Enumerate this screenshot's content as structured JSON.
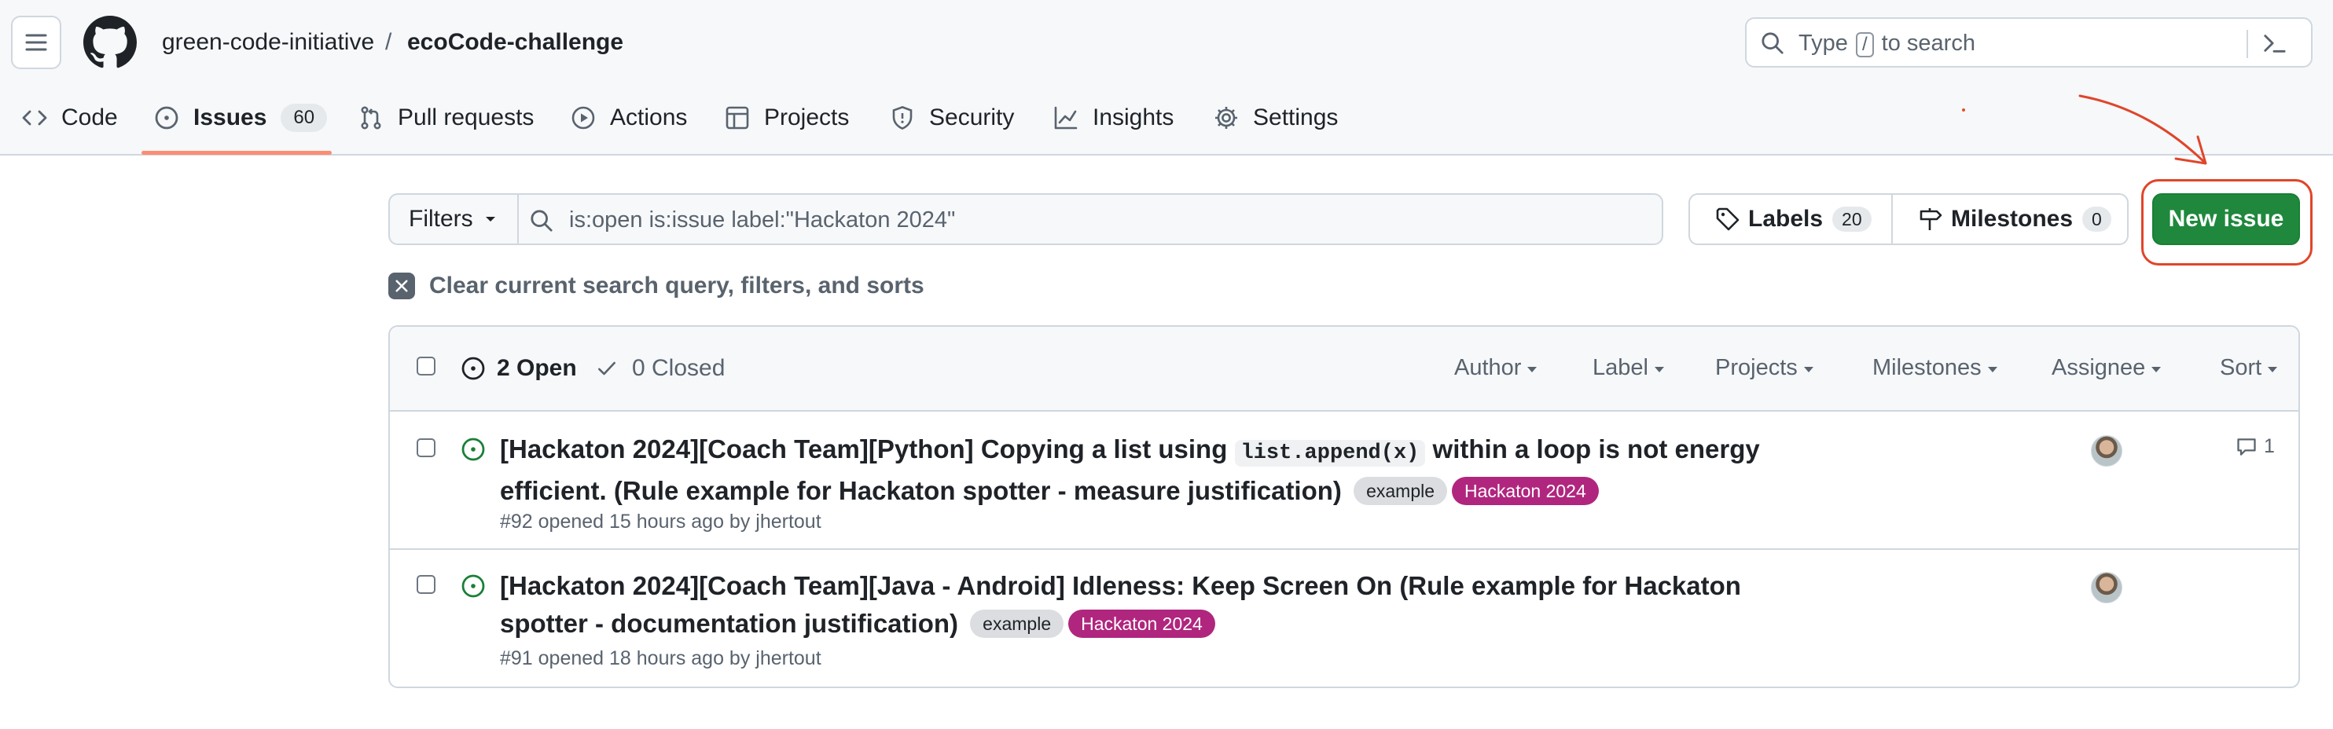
{
  "header": {
    "owner": "green-code-initiative",
    "separator": "/",
    "repo": "ecoCode-challenge",
    "search_prefix": "Type",
    "search_key": "/",
    "search_suffix": "to search"
  },
  "tabs": [
    {
      "label": "Code",
      "icon": "code-icon"
    },
    {
      "label": "Issues",
      "count": "60",
      "icon": "issue-opened-icon",
      "active": true
    },
    {
      "label": "Pull requests",
      "icon": "git-pull-request-icon"
    },
    {
      "label": "Actions",
      "icon": "play-icon"
    },
    {
      "label": "Projects",
      "icon": "table-icon"
    },
    {
      "label": "Security",
      "icon": "shield-icon"
    },
    {
      "label": "Insights",
      "icon": "graph-icon"
    },
    {
      "label": "Settings",
      "icon": "gear-icon"
    }
  ],
  "toolbar": {
    "filters_label": "Filters",
    "query": "is:open is:issue label:\"Hackaton 2024\"",
    "labels_label": "Labels",
    "labels_count": "20",
    "milestones_label": "Milestones",
    "milestones_count": "0",
    "new_issue_label": "New issue",
    "clear_label": "Clear current search query, filters, and sorts"
  },
  "list_header": {
    "open_label": "2 Open",
    "closed_label": "0 Closed",
    "filters": [
      "Author",
      "Label",
      "Projects",
      "Milestones",
      "Assignee",
      "Sort"
    ]
  },
  "issues": [
    {
      "title_pre": "[Hackaton 2024][Coach Team][Python] Copying a list using",
      "title_code": "list.append(x)",
      "title_post": "within a loop is not energy efficient. (Rule example for Hackaton spotter - measure justification)",
      "labels": [
        "example",
        "Hackaton 2024"
      ],
      "meta": "#92 opened 15 hours ago by jhertout",
      "comments": "1"
    },
    {
      "title_pre": "[Hackaton 2024][Coach Team][Java - Android] Idleness: Keep Screen On (Rule example for Hackaton spotter - documentation justification)",
      "labels": [
        "example",
        "Hackaton 2024"
      ],
      "meta": "#91 opened 18 hours ago by jhertout"
    }
  ],
  "colors": {
    "accent_green": "#1f883d",
    "label_hackaton": "#b0267e",
    "label_example": "#dbdde0",
    "tab_underline": "#fd8c73",
    "annotation_red": "#e0452a"
  }
}
